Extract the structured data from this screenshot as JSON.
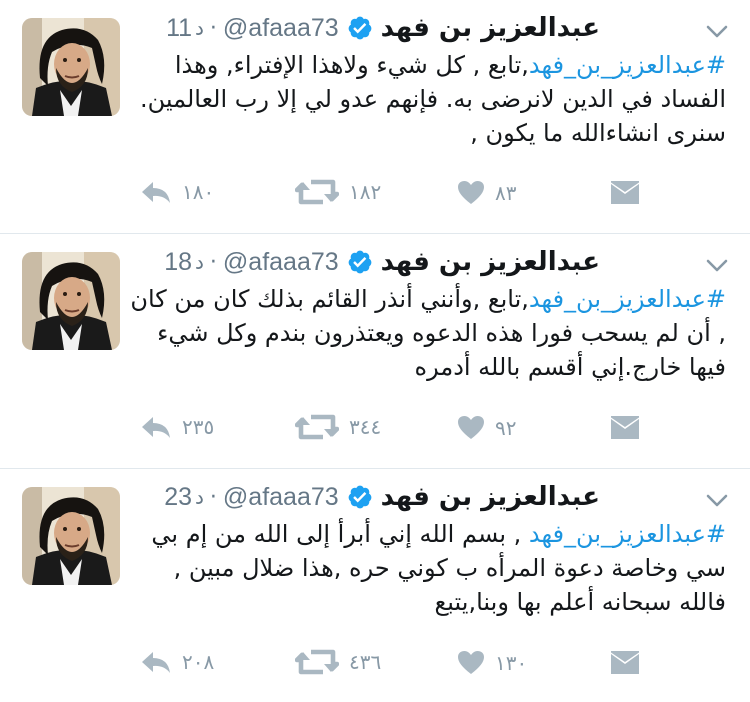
{
  "tweets": [
    {
      "name": "عبدالعزيز بن فهد",
      "handle": "@afaaa73",
      "time_value": "11",
      "time_unit": "د",
      "separator": "·",
      "hashtag": "#عبدالعزيز_بن_فهد",
      "text": ",تابع , كل شيء ولاهذا الإفتراء, وهذا الفساد في الدين لانرضى به. فإنهم عدو لي إلا رب العالمين. سنرى انشاءالله ما يكون ,",
      "replies": "١٨٠",
      "retweets": "١٨٢",
      "likes": "٨٣"
    },
    {
      "name": "عبدالعزيز بن فهد",
      "handle": "@afaaa73",
      "time_value": "18",
      "time_unit": "د",
      "separator": "·",
      "hashtag": "#عبدالعزيز_بن_فهد",
      "text": ",تابع ,وأنني أنذر القائم بذلك كان من كان , أن لم يسحب فورا هذه الدعوه ويعتذرون بندم وكل شيء فيها خارج.إني أقسم بالله أدمره",
      "replies": "٢٣٥",
      "retweets": "٣٤٤",
      "likes": "٩٢"
    },
    {
      "name": "عبدالعزيز بن فهد",
      "handle": "@afaaa73",
      "time_value": "23",
      "time_unit": "د",
      "separator": "·",
      "hashtag": "#عبدالعزيز_بن_فهد",
      "text": "  , بسم الله إني أبرأ إلى الله من إم بي سي وخاصة دعوة المرأه ب كوني حره ,هذا ضلال مبين , فالله سبحانه أعلم بها وبنا,يتبع",
      "replies": "٢٠٨",
      "retweets": "٤٣٦",
      "likes": "١٣٠"
    }
  ],
  "icons": {
    "avatar": "profile-photo",
    "verified": "verified-badge-icon",
    "menu": "chevron-down-icon",
    "reply": "reply-arrow-icon",
    "retweet": "retweet-icon",
    "like": "heart-icon",
    "message": "envelope-icon"
  },
  "colors": {
    "hashtag": "#1b95e0",
    "verified": "#1da1f2",
    "meta_text": "#657786",
    "action_gray": "#aab8c2",
    "divider": "#e1e8ed"
  }
}
